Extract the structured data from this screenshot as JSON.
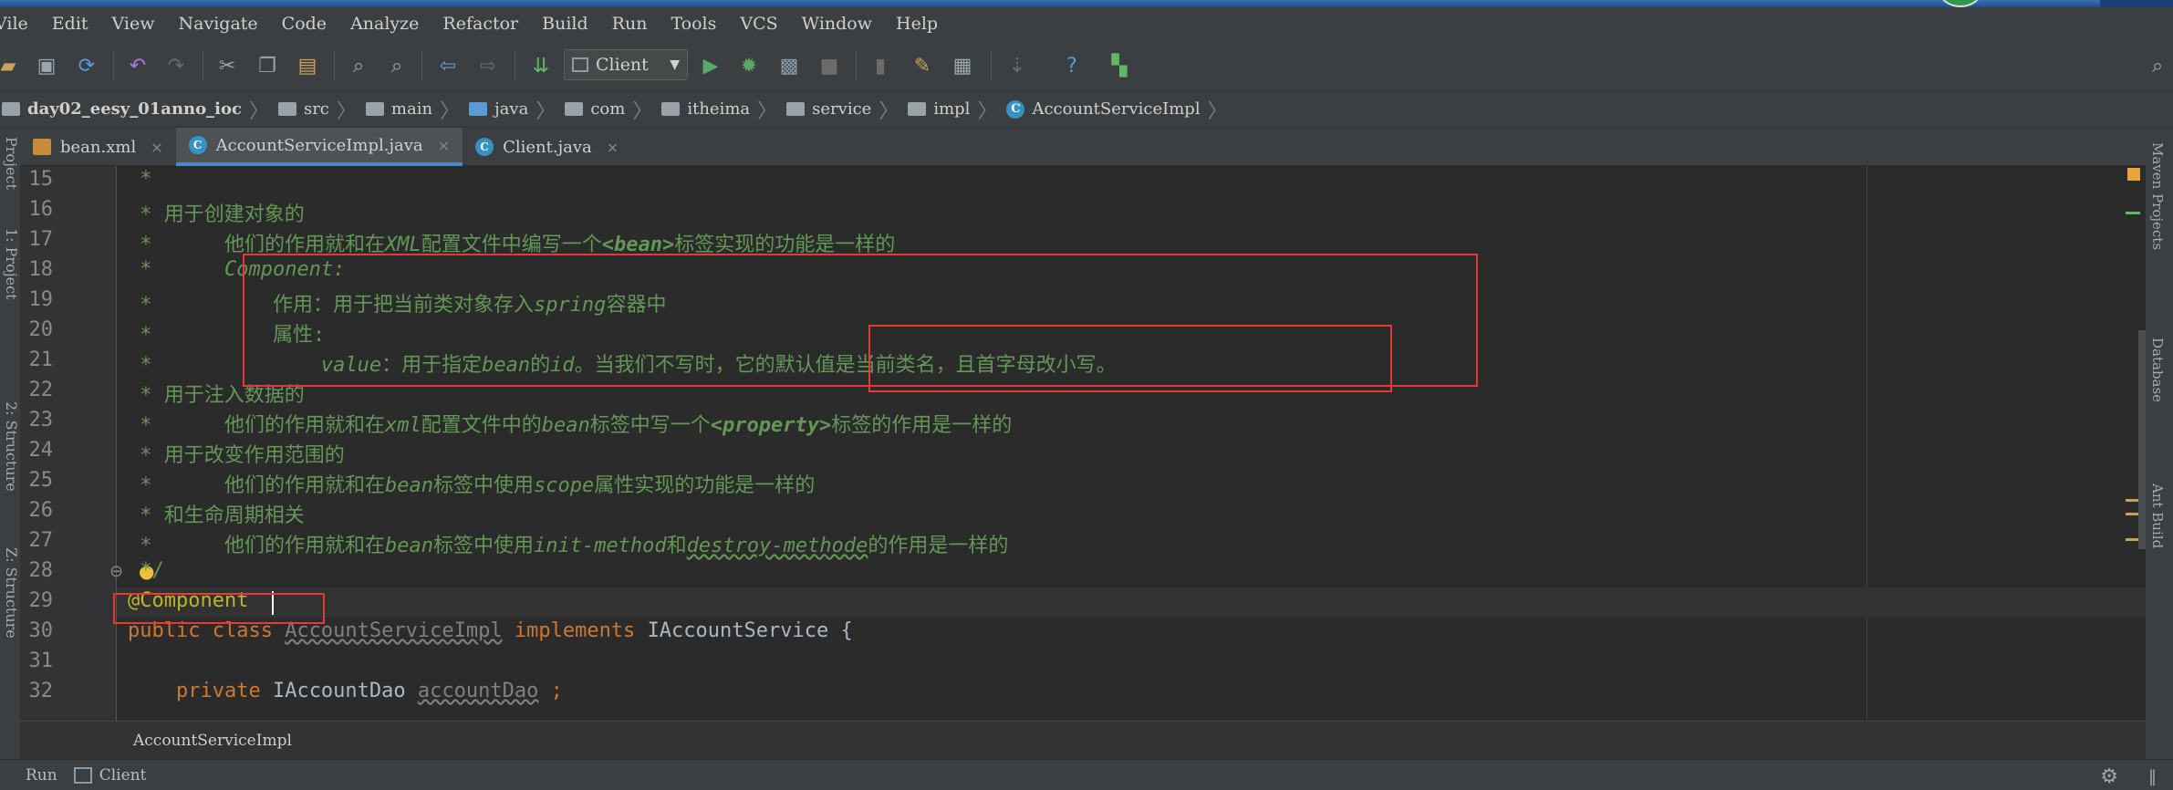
{
  "menu": [
    "Vile",
    "Edit",
    "View",
    "Navigate",
    "Code",
    "Analyze",
    "Refactor",
    "Build",
    "Run",
    "Tools",
    "VCS",
    "Window",
    "Help"
  ],
  "toolbar": {
    "run_config": "Client"
  },
  "breadcrumb": [
    "day02_eesy_01anno_ioc",
    "src",
    "main",
    "java",
    "com",
    "itheima",
    "service",
    "impl",
    "AccountServiceImpl"
  ],
  "tabs": [
    {
      "label": "bean.xml",
      "close": "×"
    },
    {
      "label": "AccountServiceImpl.java",
      "close": "×"
    },
    {
      "label": "Client.java",
      "close": "×"
    }
  ],
  "left_tool_windows": [
    "Project",
    "1: Project",
    "2: Structure",
    "Z: Structure"
  ],
  "right_tool_windows": [
    "Maven Projects",
    "Database",
    "Ant Build"
  ],
  "editor": {
    "line_numbers": [
      "15",
      "16",
      "17",
      "18",
      "19",
      "20",
      "21",
      "22",
      "23",
      "24",
      "25",
      "26",
      "27",
      "28",
      "29",
      "30",
      "31",
      "32"
    ],
    "lines": {
      "l15": " *",
      "l16": " * 用于创建对象的",
      "l17_a": " *      他们的作用就和在",
      "l17_b": "XML",
      "l17_c": "配置文件中编写一个",
      "l17_d": "<bean>",
      "l17_e": "标签实现的功能是一样的",
      "l18_a": " *      ",
      "l18_b": "Component:",
      "l19_a": " *          作用：用于把当前类对象存入",
      "l19_b": "spring",
      "l19_c": "容器中",
      "l20": " *          属性:",
      "l21_a": " *              ",
      "l21_b": "value",
      "l21_c": "：用于指定",
      "l21_d": "bean",
      "l21_e": "的",
      "l21_f": "id",
      "l21_g": "。当我们不写时，它的默认值是当前类名，且首字母改小写。",
      "l22": " * 用于注入数据的",
      "l23_a": " *      他们的作用就和在",
      "l23_b": "xml",
      "l23_c": "配置文件中的",
      "l23_d": "bean",
      "l23_e": "标签中写一个",
      "l23_f": "<property>",
      "l23_g": "标签的作用是一样的",
      "l24": " * 用于改变作用范围的",
      "l25_a": " *      他们的作用就和在",
      "l25_b": "bean",
      "l25_c": "标签中使用",
      "l25_d": "scope",
      "l25_e": "属性实现的功能是一样的",
      "l26": " * 和生命周期相关",
      "l27_a": " *      他们的作用就和在",
      "l27_b": "bean",
      "l27_c": "标签中使用",
      "l27_d": "init-method",
      "l27_e": "和",
      "l27_f": "destroy-methode",
      "l27_g": "的作用是一样的",
      "l28": " */",
      "l29": "@Component",
      "l30_kw1": "public class ",
      "l30_name": "AccountServiceImpl",
      "l30_kw2": " implements ",
      "l30_iface": "IAccountService {",
      "l32_kw": "    private ",
      "l32_type": "IAccountDao ",
      "l32_field": "accountDao",
      "l32_end": " ;"
    }
  },
  "footer_breadcrumb": "AccountServiceImpl",
  "status": {
    "run_label": "Run",
    "client_label": "Client"
  },
  "colors": {
    "comment": "#629755",
    "keyword": "#cc7832",
    "annotation": "#bbb529",
    "highlight_box": "#e53935"
  }
}
